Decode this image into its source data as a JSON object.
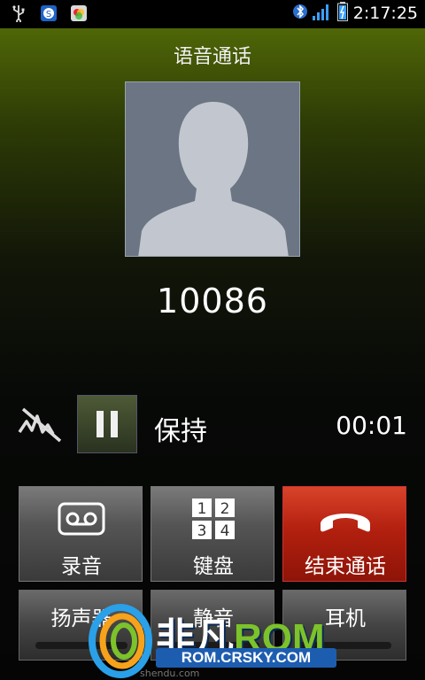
{
  "status_bar": {
    "time": "2:17:25",
    "icons": [
      "usb-icon",
      "app-s-icon",
      "app-color-icon",
      "bluetooth-icon",
      "signal-icon",
      "battery-icon"
    ]
  },
  "call": {
    "title": "语音通话",
    "number": "10086",
    "hold_label": "保持",
    "timer": "00:01"
  },
  "buttons": {
    "record": "录音",
    "keypad": "键盘",
    "keypad_digits": [
      "1",
      "2",
      "3",
      "4"
    ],
    "end_call": "结束通话",
    "speaker": "扬声器",
    "mute": "静音",
    "headset": "耳机"
  },
  "watermark": {
    "brand_cn": "非凡",
    "brand_en": "ROM",
    "url": "ROM.CRSKY.COM",
    "small": "shendu.com"
  },
  "colors": {
    "end_call": "#b3200f",
    "header_green": "#4f6607",
    "photo_bg": "#6b7583"
  }
}
